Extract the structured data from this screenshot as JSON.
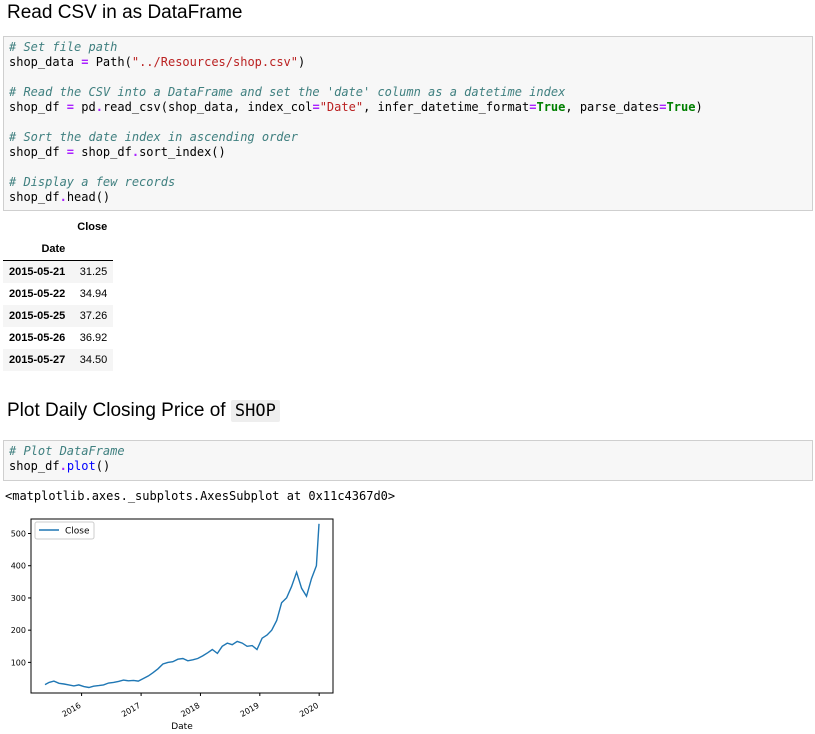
{
  "section1": {
    "title": "Read CSV in as DataFrame",
    "code": {
      "l1": "# Set file path",
      "l2_a": "shop_data ",
      "l2_b": "=",
      "l2_c": " Path(",
      "l2_d": "\"../Resources/shop.csv\"",
      "l2_e": ")",
      "l4": "# Read the CSV into a DataFrame and set the 'date' column as a datetime index",
      "l5_a": "shop_df ",
      "l5_b": "=",
      "l5_c": " pd",
      "l5_d": ".",
      "l5_e": "read_csv(shop_data, index_col",
      "l5_f": "=",
      "l5_g": "\"Date\"",
      "l5_h": ", infer_datetime_format",
      "l5_i": "=",
      "l5_j": "True",
      "l5_k": ", parse_dates",
      "l5_l": "=",
      "l5_m": "True",
      "l5_n": ")",
      "l7": "# Sort the date index in ascending order",
      "l8_a": "shop_df ",
      "l8_b": "=",
      "l8_c": " shop_df",
      "l8_d": ".",
      "l8_e": "sort_index()",
      "l10": "# Display a few records",
      "l11_a": "shop_df",
      "l11_b": ".",
      "l11_c": "head()"
    }
  },
  "dataframe": {
    "column": "Close",
    "index_name": "Date",
    "rows": [
      {
        "date": "2015-05-21",
        "close": "31.25"
      },
      {
        "date": "2015-05-22",
        "close": "34.94"
      },
      {
        "date": "2015-05-25",
        "close": "37.26"
      },
      {
        "date": "2015-05-26",
        "close": "36.92"
      },
      {
        "date": "2015-05-27",
        "close": "34.50"
      }
    ]
  },
  "section2": {
    "title_prefix": "Plot Daily Closing Price of ",
    "title_code": "SHOP",
    "code": {
      "l1": "# Plot DataFrame",
      "l2_a": "shop_df",
      "l2_b": ".",
      "l2_c": "plot",
      "l2_d": "()"
    },
    "output": "<matplotlib.axes._subplots.AxesSubplot at 0x11c4367d0>"
  },
  "chart_data": {
    "type": "line",
    "series": [
      {
        "name": "Close",
        "color": "#1f77b4",
        "x": [
          "2015-05-21",
          "2015-06-15",
          "2015-07-15",
          "2015-08-15",
          "2015-09-15",
          "2015-10-15",
          "2015-11-15",
          "2015-12-15",
          "2016-01-15",
          "2016-02-15",
          "2016-03-15",
          "2016-04-15",
          "2016-05-15",
          "2016-06-15",
          "2016-07-15",
          "2016-08-15",
          "2016-09-15",
          "2016-10-15",
          "2016-11-15",
          "2016-12-15",
          "2017-01-15",
          "2017-02-15",
          "2017-03-15",
          "2017-04-15",
          "2017-05-15",
          "2017-06-15",
          "2017-07-15",
          "2017-08-15",
          "2017-09-15",
          "2017-10-15",
          "2017-11-15",
          "2017-12-15",
          "2018-01-15",
          "2018-02-15",
          "2018-03-15",
          "2018-04-15",
          "2018-05-15",
          "2018-06-15",
          "2018-07-15",
          "2018-08-15",
          "2018-09-15",
          "2018-10-15",
          "2018-11-15",
          "2018-12-15",
          "2019-01-15",
          "2019-02-15",
          "2019-03-15",
          "2019-04-15",
          "2019-05-15",
          "2019-06-15",
          "2019-07-15",
          "2019-08-15",
          "2019-09-15",
          "2019-10-15",
          "2019-11-15",
          "2019-12-15",
          "2019-12-31"
        ],
        "values": [
          31,
          38,
          42,
          35,
          33,
          30,
          27,
          30,
          25,
          22,
          26,
          28,
          30,
          36,
          38,
          41,
          45,
          43,
          44,
          42,
          50,
          58,
          68,
          80,
          95,
          100,
          102,
          110,
          112,
          105,
          108,
          112,
          120,
          130,
          140,
          128,
          150,
          160,
          155,
          165,
          160,
          150,
          152,
          140,
          175,
          185,
          200,
          230,
          285,
          300,
          335,
          380,
          330,
          305,
          360,
          400,
          530
        ]
      }
    ],
    "xlabel": "Date",
    "ylabel": "",
    "xticks": [
      "2016",
      "2017",
      "2018",
      "2019",
      "2020"
    ],
    "yticks": [
      "100",
      "200",
      "300",
      "400",
      "500"
    ],
    "ylim": [
      5,
      545
    ],
    "xlim": [
      "2015-05-21",
      "2019-12-31"
    ],
    "legend": "upper-left",
    "grid": false
  }
}
